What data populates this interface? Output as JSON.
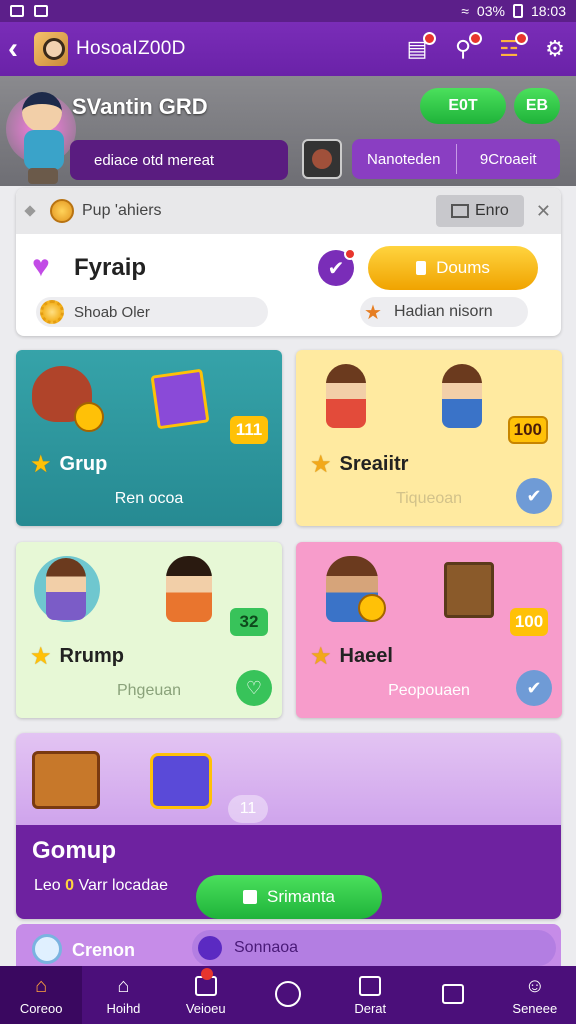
{
  "status": {
    "signal": "☰",
    "battery_text": "03%",
    "time": "18:03"
  },
  "appbar": {
    "title": "HosoaIZ00D"
  },
  "profile": {
    "name": "SVantin GRD",
    "edit_label": "E0T",
    "share_label": "EB",
    "status_text": "ediace otd mereat",
    "stat_left": "Nanoteden",
    "stat_right": "9Croaeit"
  },
  "info": {
    "top_label": "Pup 'ahiers",
    "tab_label": "Enro",
    "row_name": "Fyraip",
    "yellow_btn": "Doums",
    "sub_left": "Shoab Oler",
    "sub_right": "Hadian nisorn"
  },
  "tiles": [
    {
      "title": "Grup",
      "sub": "Ren ocoa",
      "badge": "111",
      "badge_color": "#ffc107"
    },
    {
      "title": "Sreaiitr",
      "sub": "Tiqueoan",
      "badge": "100",
      "badge_color": "#ffc107"
    },
    {
      "title": "Rrump",
      "sub": "Phgeuan",
      "badge": "32",
      "badge_color": "#38c35a"
    },
    {
      "title": "Haeel",
      "sub": "Peopouaen",
      "badge": "100",
      "badge_color": "#ffc107"
    }
  ],
  "feature": {
    "title": "Gomup",
    "sub_prefix": "Leo ",
    "sub_count": "0",
    "sub_suffix": " Varr locadae",
    "button": "Srimanta",
    "pager": "11"
  },
  "strip": {
    "label": "Crenon",
    "pill": "Sonnaoa"
  },
  "nav": [
    {
      "label": "Coreoo",
      "icon": "home-icon"
    },
    {
      "label": "Hoihd",
      "icon": "house-outline-icon"
    },
    {
      "label": "Veioeu",
      "icon": "t-box-icon"
    },
    {
      "label": "",
      "icon": "circle-icon"
    },
    {
      "label": "Derat",
      "icon": "photo-icon"
    },
    {
      "label": "",
      "icon": "window-icon"
    },
    {
      "label": "Seneee",
      "icon": "person-icon"
    }
  ],
  "colors": {
    "brand": "#7a2db8",
    "green": "#1fb33a",
    "yellow": "#f0a300"
  }
}
